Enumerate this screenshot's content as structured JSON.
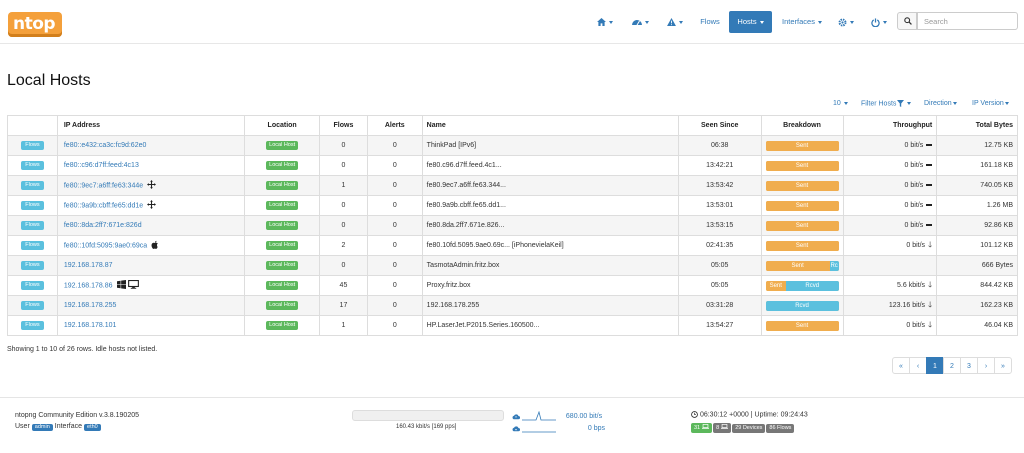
{
  "app": {
    "logo_text": "ntop",
    "brand_color": "#f4a03b",
    "accent": "#337ab7"
  },
  "nav": {
    "home_icon": "home-icon",
    "dashboard_icon": "dashboard-icon",
    "alerts_icon": "warning-icon",
    "flows": "Flows",
    "hosts": "Hosts",
    "interfaces": "Interfaces",
    "settings_icon": "gear-icon",
    "power_icon": "power-icon",
    "search_placeholder": "Search"
  },
  "page_title": "Local Hosts",
  "toolbar": {
    "per_page": "10",
    "filter": "Filter Hosts",
    "direction": "Direction",
    "ip_version": "IP Version"
  },
  "table": {
    "headers": {
      "ip": "IP Address",
      "location": "Location",
      "flows": "Flows",
      "alerts": "Alerts",
      "name": "Name",
      "seen": "Seen Since",
      "breakdown": "Breakdown",
      "throughput": "Throughput",
      "bytes": "Total Bytes"
    },
    "flows_button": "Flows",
    "rows": [
      {
        "ip": "fe80::e432:ca3c:fc9d:62e0",
        "icon": "",
        "location": "Local Host",
        "flows": "0",
        "alerts": "0",
        "name": "ThinkPad [IPv6]",
        "seen": "06:38",
        "sent_pct": 100,
        "sent_label": "Sent",
        "rcvd_label": "",
        "throughput": "0 bit/s",
        "trend": "flat",
        "bytes": "12.75 KB"
      },
      {
        "ip": "fe80::c96:d7ff:feed:4c13",
        "icon": "",
        "location": "Local Host",
        "flows": "0",
        "alerts": "0",
        "name": "fe80.c96.d7ff.feed.4c1...",
        "seen": "13:42:21",
        "sent_pct": 100,
        "sent_label": "Sent",
        "rcvd_label": "",
        "throughput": "0 bit/s",
        "trend": "flat",
        "bytes": "161.18 KB"
      },
      {
        "ip": "fe80::9ec7:a6ff:fe63:344e",
        "icon": "move",
        "location": "Local Host",
        "flows": "1",
        "alerts": "0",
        "name": "fe80.9ec7.a6ff.fe63.344...",
        "seen": "13:53:42",
        "sent_pct": 100,
        "sent_label": "Sent",
        "rcvd_label": "",
        "throughput": "0 bit/s",
        "trend": "flat",
        "bytes": "740.05 KB"
      },
      {
        "ip": "fe80::9a9b:cbff:fe65:dd1e",
        "icon": "move",
        "location": "Local Host",
        "flows": "0",
        "alerts": "0",
        "name": "fe80.9a9b.cbff.fe65.dd1...",
        "seen": "13:53:01",
        "sent_pct": 100,
        "sent_label": "Sent",
        "rcvd_label": "",
        "throughput": "0 bit/s",
        "trend": "flat",
        "bytes": "1.26 MB"
      },
      {
        "ip": "fe80::8da:2ff7:671e:826d",
        "icon": "",
        "location": "Local Host",
        "flows": "0",
        "alerts": "0",
        "name": "fe80.8da.2ff7.671e.826...",
        "seen": "13:53:15",
        "sent_pct": 100,
        "sent_label": "Sent",
        "rcvd_label": "",
        "throughput": "0 bit/s",
        "trend": "flat",
        "bytes": "92.86 KB"
      },
      {
        "ip": "fe80::10fd:5095:9ae0:69ca",
        "icon": "apple",
        "location": "Local Host",
        "flows": "2",
        "alerts": "0",
        "name": "fe80.10fd.5095.9ae0.69c... [iPhonevielaKeil]",
        "seen": "02:41:35",
        "sent_pct": 100,
        "sent_label": "Sent",
        "rcvd_label": "",
        "throughput": "0 bit/s",
        "trend": "down",
        "bytes": "101.12 KB"
      },
      {
        "ip": "192.168.178.87",
        "icon": "",
        "location": "Local Host",
        "flows": "0",
        "alerts": "0",
        "name": "TasmotaAdmin.fritz.box",
        "seen": "05:05",
        "sent_pct": 88,
        "sent_label": "Sent",
        "rcvd_label": "Rc",
        "throughput": "",
        "trend": "none",
        "bytes": "666 Bytes"
      },
      {
        "ip": "192.168.178.86",
        "icon": "windows-monitor",
        "location": "Local Host",
        "flows": "45",
        "alerts": "0",
        "name": "Proxy.fritz.box",
        "seen": "05:05",
        "sent_pct": 28,
        "sent_label": "Sent",
        "rcvd_label": "Rcvd",
        "throughput": "5.6 kbit/s",
        "trend": "down",
        "bytes": "844.42 KB"
      },
      {
        "ip": "192.168.178.255",
        "icon": "",
        "location": "Local Host",
        "flows": "17",
        "alerts": "0",
        "name": "192.168.178.255",
        "seen": "03:31:28",
        "sent_pct": 0,
        "sent_label": "",
        "rcvd_label": "Rcvd",
        "throughput": "123.16 bit/s",
        "trend": "down",
        "bytes": "162.23 KB"
      },
      {
        "ip": "192.168.178.101",
        "icon": "",
        "location": "Local Host",
        "flows": "1",
        "alerts": "0",
        "name": "HP.LaserJet.P2015.Series.160500...",
        "seen": "13:54:27",
        "sent_pct": 100,
        "sent_label": "Sent",
        "rcvd_label": "",
        "throughput": "0 bit/s",
        "trend": "down",
        "bytes": "46.04 KB"
      }
    ]
  },
  "showing_text": "Showing 1 to 10 of 26 rows. Idle hosts not listed.",
  "pagination": [
    "«",
    "‹",
    "1",
    "2",
    "3",
    "›",
    "»"
  ],
  "pagination_active": "1",
  "footer": {
    "edition": "ntopng Community Edition v.3.8.190205",
    "user_label": "User",
    "user": "admin",
    "interface_label": "Interface",
    "interface": "eth0",
    "gauge_text": "160.43 kbit/s [169 pps]",
    "gauge_fill": 0.0,
    "upload_rate": "680.00 bit/s",
    "download_rate": "0 bps",
    "time": "06:30:12 +0000 | Uptime: 09:24:43",
    "badges": [
      {
        "label": "31",
        "icon": "laptop-icon",
        "color": "#5cb85c"
      },
      {
        "label": "8",
        "icon": "laptop-icon",
        "color": "#777777"
      },
      {
        "label": "29 Devices",
        "icon": "",
        "color": "#777777"
      },
      {
        "label": "86 Flows",
        "icon": "",
        "color": "#777777"
      }
    ]
  }
}
